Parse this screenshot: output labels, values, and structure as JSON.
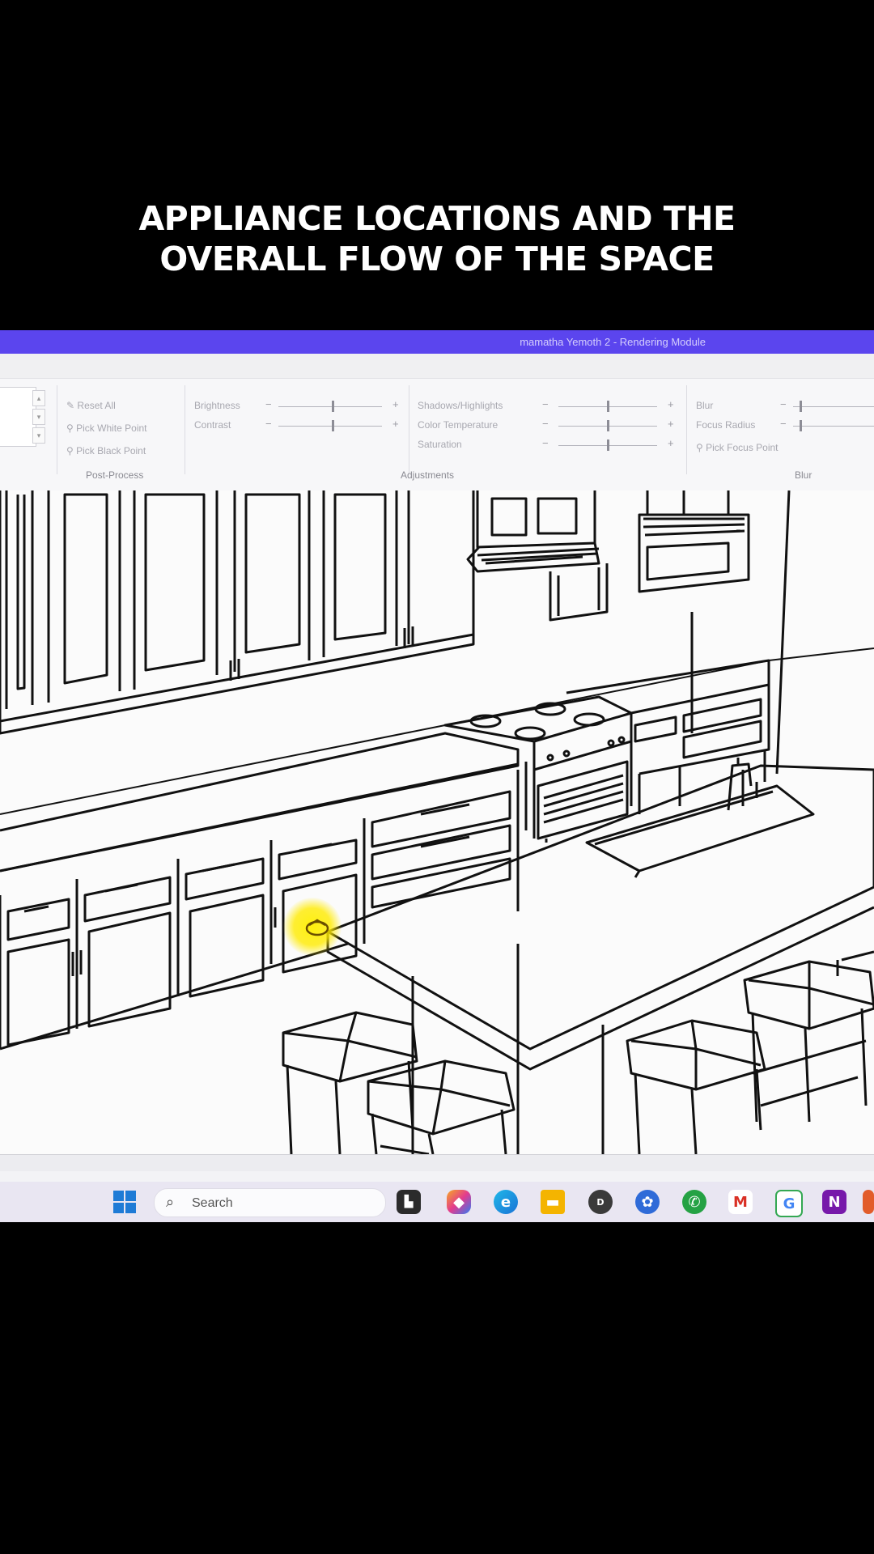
{
  "caption": {
    "line1": "APPLIANCE LOCATIONS AND THE",
    "line2": "OVERALL FLOW OF THE SPACE"
  },
  "window": {
    "title": "mamatha Yemoth 2 - Rendering Module",
    "accent_color": "#5b45ee"
  },
  "ribbon": {
    "post_process": {
      "group_label": "Post-Process",
      "reset_all": "Reset All",
      "pick_white_point": "Pick White Point",
      "pick_black_point": "Pick Black Point"
    },
    "adjustments": {
      "group_label": "Adjustments",
      "brightness": "Brightness",
      "contrast": "Contrast",
      "shadows_highlights": "Shadows/Highlights",
      "color_temperature": "Color Temperature",
      "saturation": "Saturation"
    },
    "blur": {
      "group_label": "Blur",
      "blur": "Blur",
      "focus_radius": "Focus Radius",
      "pick_focus_point": "Pick Focus Point"
    },
    "plus": "+",
    "minus": "−"
  },
  "canvas": {
    "subject": "kitchen-line-drawing",
    "cursor_highlight_color": "#ffeb00"
  },
  "taskbar": {
    "search_placeholder": "Search",
    "icons": [
      "windows-start-icon",
      "search-icon",
      "task-view-icon",
      "copilot-icon",
      "edge-icon",
      "file-explorer-icon",
      "dell-icon",
      "app-icon",
      "whatsapp-icon",
      "gmail-icon",
      "google-icon",
      "onenote-icon"
    ]
  }
}
